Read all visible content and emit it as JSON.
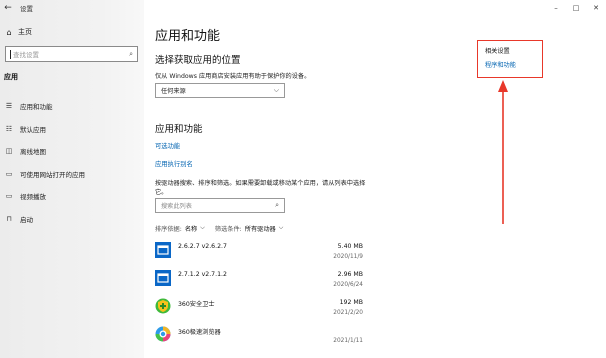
{
  "window": {
    "title": "设置",
    "back_glyph": "←",
    "controls": {
      "minimize": "–",
      "maximize": "□",
      "close": "✕"
    }
  },
  "sidebar": {
    "home_label": "主页",
    "search_placeholder": "查找设置",
    "section_label": "应用",
    "items": [
      {
        "label": "应用和功能",
        "icon": "apps-features-icon",
        "glyph": "☰"
      },
      {
        "label": "默认应用",
        "icon": "default-apps-icon",
        "glyph": "☷"
      },
      {
        "label": "离线地图",
        "icon": "offline-maps-icon",
        "glyph": "◫"
      },
      {
        "label": "可使用网站打开的应用",
        "icon": "apps-for-websites-icon",
        "glyph": "▭"
      },
      {
        "label": "视频播放",
        "icon": "video-playback-icon",
        "glyph": "▭"
      },
      {
        "label": "启动",
        "icon": "startup-icon",
        "glyph": "⊓"
      }
    ]
  },
  "main": {
    "title": "应用和功能",
    "install_section": {
      "heading": "选择获取应用的位置",
      "description": "仅从 Windows 应用商店安装应用有助于保护你的设备。",
      "dropdown_value": "任何来源"
    },
    "apps_section": {
      "heading": "应用和功能",
      "link_optional": "可选功能",
      "link_aliases": "应用执行别名",
      "description": "按驱动器搜索、排序和筛选。如果需要卸载或移动某个应用，请从列表中选择它。",
      "search_placeholder": "搜索此列表",
      "sort_label": "排序依据:",
      "sort_value": "名称",
      "filter_label": "筛选条件:",
      "filter_value": "所有驱动器"
    },
    "apps": [
      {
        "name": "2.6.2.7 v2.6.2.7",
        "size": "5.40 MB",
        "date": "2020/11/9",
        "icon": "app-window-icon"
      },
      {
        "name": "2.7.1.2 v2.7.1.2",
        "size": "2.96 MB",
        "date": "2020/6/24",
        "icon": "app-window-icon"
      },
      {
        "name": "360安全卫士",
        "size": "192 MB",
        "date": "2021/2/20",
        "icon": "360-safe-icon"
      },
      {
        "name": "360极速浏览器",
        "size": "",
        "date": "2021/1/11",
        "icon": "360-browser-icon"
      }
    ]
  },
  "related": {
    "title": "相关设置",
    "link": "程序和功能"
  },
  "colors": {
    "accent": "#0063b1",
    "annotation": "#e8382a",
    "app_tile": "#0a67c7"
  }
}
